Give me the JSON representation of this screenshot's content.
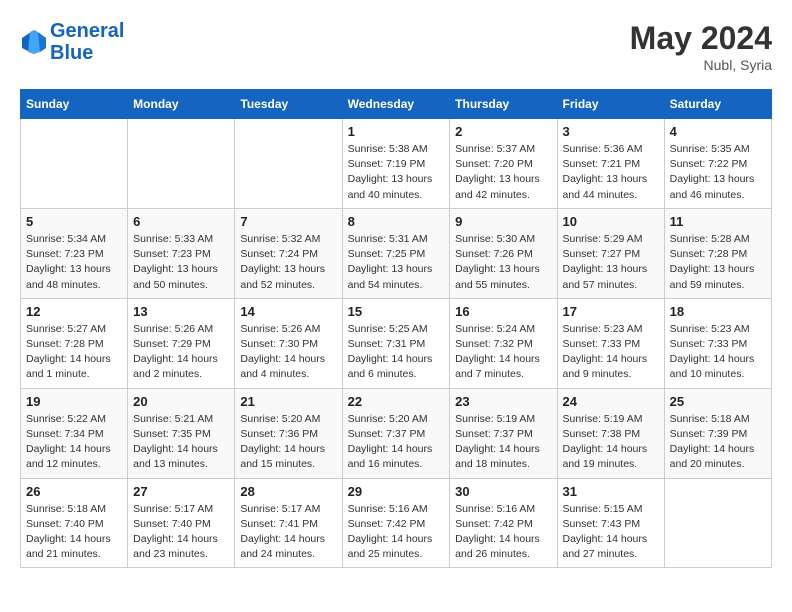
{
  "header": {
    "logo_line1": "General",
    "logo_line2": "Blue",
    "month_year": "May 2024",
    "location": "Nubl, Syria"
  },
  "days_of_week": [
    "Sunday",
    "Monday",
    "Tuesday",
    "Wednesday",
    "Thursday",
    "Friday",
    "Saturday"
  ],
  "weeks": [
    [
      {
        "day": "",
        "sunrise": "",
        "sunset": "",
        "daylight": ""
      },
      {
        "day": "",
        "sunrise": "",
        "sunset": "",
        "daylight": ""
      },
      {
        "day": "",
        "sunrise": "",
        "sunset": "",
        "daylight": ""
      },
      {
        "day": "1",
        "sunrise": "Sunrise: 5:38 AM",
        "sunset": "Sunset: 7:19 PM",
        "daylight": "Daylight: 13 hours and 40 minutes."
      },
      {
        "day": "2",
        "sunrise": "Sunrise: 5:37 AM",
        "sunset": "Sunset: 7:20 PM",
        "daylight": "Daylight: 13 hours and 42 minutes."
      },
      {
        "day": "3",
        "sunrise": "Sunrise: 5:36 AM",
        "sunset": "Sunset: 7:21 PM",
        "daylight": "Daylight: 13 hours and 44 minutes."
      },
      {
        "day": "4",
        "sunrise": "Sunrise: 5:35 AM",
        "sunset": "Sunset: 7:22 PM",
        "daylight": "Daylight: 13 hours and 46 minutes."
      }
    ],
    [
      {
        "day": "5",
        "sunrise": "Sunrise: 5:34 AM",
        "sunset": "Sunset: 7:23 PM",
        "daylight": "Daylight: 13 hours and 48 minutes."
      },
      {
        "day": "6",
        "sunrise": "Sunrise: 5:33 AM",
        "sunset": "Sunset: 7:23 PM",
        "daylight": "Daylight: 13 hours and 50 minutes."
      },
      {
        "day": "7",
        "sunrise": "Sunrise: 5:32 AM",
        "sunset": "Sunset: 7:24 PM",
        "daylight": "Daylight: 13 hours and 52 minutes."
      },
      {
        "day": "8",
        "sunrise": "Sunrise: 5:31 AM",
        "sunset": "Sunset: 7:25 PM",
        "daylight": "Daylight: 13 hours and 54 minutes."
      },
      {
        "day": "9",
        "sunrise": "Sunrise: 5:30 AM",
        "sunset": "Sunset: 7:26 PM",
        "daylight": "Daylight: 13 hours and 55 minutes."
      },
      {
        "day": "10",
        "sunrise": "Sunrise: 5:29 AM",
        "sunset": "Sunset: 7:27 PM",
        "daylight": "Daylight: 13 hours and 57 minutes."
      },
      {
        "day": "11",
        "sunrise": "Sunrise: 5:28 AM",
        "sunset": "Sunset: 7:28 PM",
        "daylight": "Daylight: 13 hours and 59 minutes."
      }
    ],
    [
      {
        "day": "12",
        "sunrise": "Sunrise: 5:27 AM",
        "sunset": "Sunset: 7:28 PM",
        "daylight": "Daylight: 14 hours and 1 minute."
      },
      {
        "day": "13",
        "sunrise": "Sunrise: 5:26 AM",
        "sunset": "Sunset: 7:29 PM",
        "daylight": "Daylight: 14 hours and 2 minutes."
      },
      {
        "day": "14",
        "sunrise": "Sunrise: 5:26 AM",
        "sunset": "Sunset: 7:30 PM",
        "daylight": "Daylight: 14 hours and 4 minutes."
      },
      {
        "day": "15",
        "sunrise": "Sunrise: 5:25 AM",
        "sunset": "Sunset: 7:31 PM",
        "daylight": "Daylight: 14 hours and 6 minutes."
      },
      {
        "day": "16",
        "sunrise": "Sunrise: 5:24 AM",
        "sunset": "Sunset: 7:32 PM",
        "daylight": "Daylight: 14 hours and 7 minutes."
      },
      {
        "day": "17",
        "sunrise": "Sunrise: 5:23 AM",
        "sunset": "Sunset: 7:33 PM",
        "daylight": "Daylight: 14 hours and 9 minutes."
      },
      {
        "day": "18",
        "sunrise": "Sunrise: 5:23 AM",
        "sunset": "Sunset: 7:33 PM",
        "daylight": "Daylight: 14 hours and 10 minutes."
      }
    ],
    [
      {
        "day": "19",
        "sunrise": "Sunrise: 5:22 AM",
        "sunset": "Sunset: 7:34 PM",
        "daylight": "Daylight: 14 hours and 12 minutes."
      },
      {
        "day": "20",
        "sunrise": "Sunrise: 5:21 AM",
        "sunset": "Sunset: 7:35 PM",
        "daylight": "Daylight: 14 hours and 13 minutes."
      },
      {
        "day": "21",
        "sunrise": "Sunrise: 5:20 AM",
        "sunset": "Sunset: 7:36 PM",
        "daylight": "Daylight: 14 hours and 15 minutes."
      },
      {
        "day": "22",
        "sunrise": "Sunrise: 5:20 AM",
        "sunset": "Sunset: 7:37 PM",
        "daylight": "Daylight: 14 hours and 16 minutes."
      },
      {
        "day": "23",
        "sunrise": "Sunrise: 5:19 AM",
        "sunset": "Sunset: 7:37 PM",
        "daylight": "Daylight: 14 hours and 18 minutes."
      },
      {
        "day": "24",
        "sunrise": "Sunrise: 5:19 AM",
        "sunset": "Sunset: 7:38 PM",
        "daylight": "Daylight: 14 hours and 19 minutes."
      },
      {
        "day": "25",
        "sunrise": "Sunrise: 5:18 AM",
        "sunset": "Sunset: 7:39 PM",
        "daylight": "Daylight: 14 hours and 20 minutes."
      }
    ],
    [
      {
        "day": "26",
        "sunrise": "Sunrise: 5:18 AM",
        "sunset": "Sunset: 7:40 PM",
        "daylight": "Daylight: 14 hours and 21 minutes."
      },
      {
        "day": "27",
        "sunrise": "Sunrise: 5:17 AM",
        "sunset": "Sunset: 7:40 PM",
        "daylight": "Daylight: 14 hours and 23 minutes."
      },
      {
        "day": "28",
        "sunrise": "Sunrise: 5:17 AM",
        "sunset": "Sunset: 7:41 PM",
        "daylight": "Daylight: 14 hours and 24 minutes."
      },
      {
        "day": "29",
        "sunrise": "Sunrise: 5:16 AM",
        "sunset": "Sunset: 7:42 PM",
        "daylight": "Daylight: 14 hours and 25 minutes."
      },
      {
        "day": "30",
        "sunrise": "Sunrise: 5:16 AM",
        "sunset": "Sunset: 7:42 PM",
        "daylight": "Daylight: 14 hours and 26 minutes."
      },
      {
        "day": "31",
        "sunrise": "Sunrise: 5:15 AM",
        "sunset": "Sunset: 7:43 PM",
        "daylight": "Daylight: 14 hours and 27 minutes."
      },
      {
        "day": "",
        "sunrise": "",
        "sunset": "",
        "daylight": ""
      }
    ]
  ]
}
